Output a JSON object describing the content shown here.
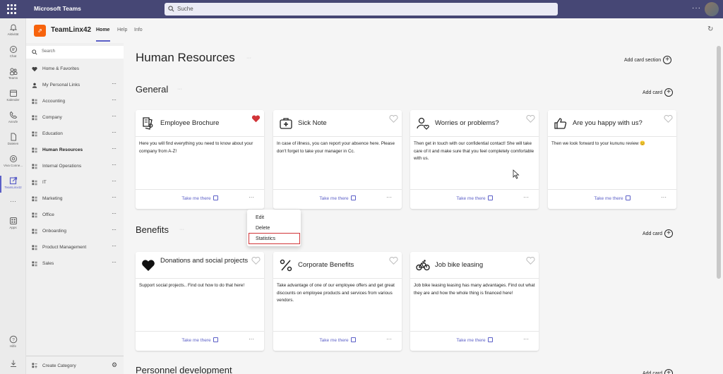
{
  "topbar": {
    "app_title": "Microsoft Teams",
    "search_placeholder": "Suche",
    "more_label": "···"
  },
  "rail": {
    "items": [
      {
        "label": "Aktivität",
        "icon": "bell-icon"
      },
      {
        "label": "Chat",
        "icon": "chat-icon"
      },
      {
        "label": "Teams",
        "icon": "teams-icon"
      },
      {
        "label": "Kalender",
        "icon": "calendar-icon"
      },
      {
        "label": "Anrufe",
        "icon": "phone-icon"
      },
      {
        "label": "Dateien",
        "icon": "file-icon"
      },
      {
        "label": "Viva Conne...",
        "icon": "viva-icon"
      },
      {
        "label": "TeamLinx42",
        "icon": "teamlinx-icon"
      },
      {
        "label": "···",
        "icon": "more-apps-icon"
      },
      {
        "label": "Apps",
        "icon": "apps-icon"
      },
      {
        "label": "Hilfe",
        "icon": "help-icon"
      }
    ]
  },
  "app": {
    "name": "TeamLinx42",
    "tabs": [
      "Home",
      "Help",
      "Info"
    ],
    "active_tab": "Home",
    "accent": "#5b5fc7",
    "logo_color": "#f7630c"
  },
  "nav": {
    "search_placeholder": "Search",
    "items": [
      {
        "label": "Home & Favorites",
        "icon": "heart-icon",
        "has_menu": false
      },
      {
        "label": "My Personal Links",
        "icon": "person-icon",
        "has_menu": true
      },
      {
        "label": "Accounting",
        "icon": "category-icon",
        "has_menu": true
      },
      {
        "label": "Company",
        "icon": "category-icon",
        "has_menu": true
      },
      {
        "label": "Education",
        "icon": "category-icon",
        "has_menu": true
      },
      {
        "label": "Human Resources",
        "icon": "category-icon",
        "has_menu": true,
        "selected": true
      },
      {
        "label": "Internal Operations",
        "icon": "category-icon",
        "has_menu": true
      },
      {
        "label": "IT",
        "icon": "category-icon",
        "has_menu": true
      },
      {
        "label": "Marketing",
        "icon": "category-icon",
        "has_menu": true
      },
      {
        "label": "Office",
        "icon": "category-icon",
        "has_menu": true
      },
      {
        "label": "Onboarding",
        "icon": "category-icon",
        "has_menu": true
      },
      {
        "label": "Product Management",
        "icon": "category-icon",
        "has_menu": true
      },
      {
        "label": "Sales",
        "icon": "category-icon",
        "has_menu": true
      }
    ],
    "dots": "···",
    "footer_label": "Create Category"
  },
  "main": {
    "page_title": "Human Resources",
    "add_section_label": "Add card section",
    "add_card_label": "Add card",
    "take_me_there": "Take me there",
    "sections": [
      {
        "title": "General",
        "cards": [
          {
            "title": "Employee Brochure",
            "icon": "brochure-icon",
            "favorite": true,
            "desc": "Here you will find everything you need to know about your company from A-Z!"
          },
          {
            "title": "Sick Note",
            "icon": "medical-kit-icon",
            "favorite": false,
            "desc": "In case of illness, you can report your absence here. Please don't forget to take your manager in Cc."
          },
          {
            "title": "Worries or problems?",
            "icon": "person-heart-icon",
            "favorite": false,
            "desc": "Then get in touch with our confidential contact! She will take care of it and make sure that you feel completely comfortable with us."
          },
          {
            "title": "Are you happy with us?",
            "icon": "thumbs-up-icon",
            "favorite": false,
            "desc": "Then we look forward to your kununu review 😊"
          }
        ]
      },
      {
        "title": "Benefits",
        "cards": [
          {
            "title": "Donations and social projects",
            "icon": "heart-filled-icon",
            "favorite": false,
            "desc": "Support social projects.. Find out how to do that here!"
          },
          {
            "title": "Corporate Benefits",
            "icon": "percent-icon",
            "favorite": false,
            "desc": "Take advantage of one of our employee offers and get great discounts on employee products and services from various vendors."
          },
          {
            "title": "Job bike leasing",
            "icon": "bike-icon",
            "favorite": false,
            "desc": "Job bike leasing leasing has many advantages. Find out what they are and how the whole thing is financed here!"
          }
        ]
      },
      {
        "title": "Personnel development",
        "cards": []
      }
    ]
  },
  "context_menu": {
    "items": [
      "Edit",
      "Delete",
      "Statistics"
    ],
    "highlighted": "Statistics",
    "highlight_color": "#d13438"
  }
}
